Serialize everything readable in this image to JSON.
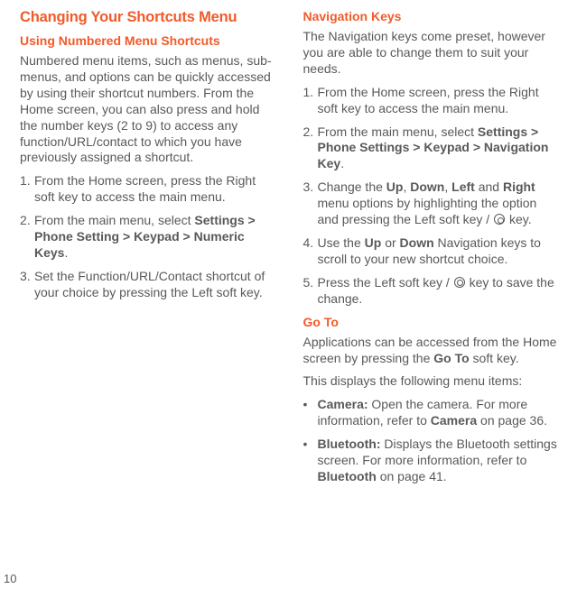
{
  "left": {
    "h1": "Changing Your Shortcuts Menu",
    "h2": "Using Numbered Menu Shortcuts",
    "intro": "Numbered menu items, such as menus, sub-menus, and options can be quickly accessed by using their shortcut numbers. From the Home screen, you can also press and hold the number keys (2 to 9) to access any function/URL/contact to which you have previously assigned a shortcut.",
    "steps": [
      "From the Home screen, press the Right soft key to access the main menu.",
      "From the main menu, select <strong>Settings > Phone Setting > Keypad > Numeric Keys</strong>.",
      "Set the Function/URL/Contact shortcut of your choice by pressing the Left soft key."
    ]
  },
  "right": {
    "nav": {
      "h2": "Navigation Keys",
      "intro": "The Navigation keys come preset, however you are able to change them to suit your needs.",
      "steps": [
        "From the Home screen, press the Right soft key to access the main menu.",
        "From the main menu, select <strong>Settings > Phone Settings > Keypad > Navigation Key</strong>.",
        "Change the <strong>Up</strong>, <strong>Down</strong>, <strong>Left</strong> and <strong>Right</strong> menu options by highlighting the option and pressing the Left soft key / <span class=\"key-icon\" data-name=\"ok-key-icon\" data-interactable=\"false\"></span> key.",
        "Use the <strong>Up</strong> or <strong>Down</strong> Navigation keys to scroll to your new shortcut choice.",
        "Press the Left soft key / <span class=\"key-icon\" data-name=\"ok-key-icon\" data-interactable=\"false\"></span> key to save the change."
      ]
    },
    "goto": {
      "h2": "Go To",
      "intro": "Applications can be accessed from the Home screen by pressing the <strong>Go To</strong> soft key.",
      "sub": "This displays the following menu items:",
      "items": [
        "<strong>Camera:</strong> Open the camera. For more information, refer to <strong>Camera</strong> on page 36.",
        "<strong>Bluetooth:</strong> Displays the Bluetooth settings screen. For more information, refer to <strong>Bluetooth</strong> on page 41."
      ]
    }
  },
  "pagenum": "10"
}
